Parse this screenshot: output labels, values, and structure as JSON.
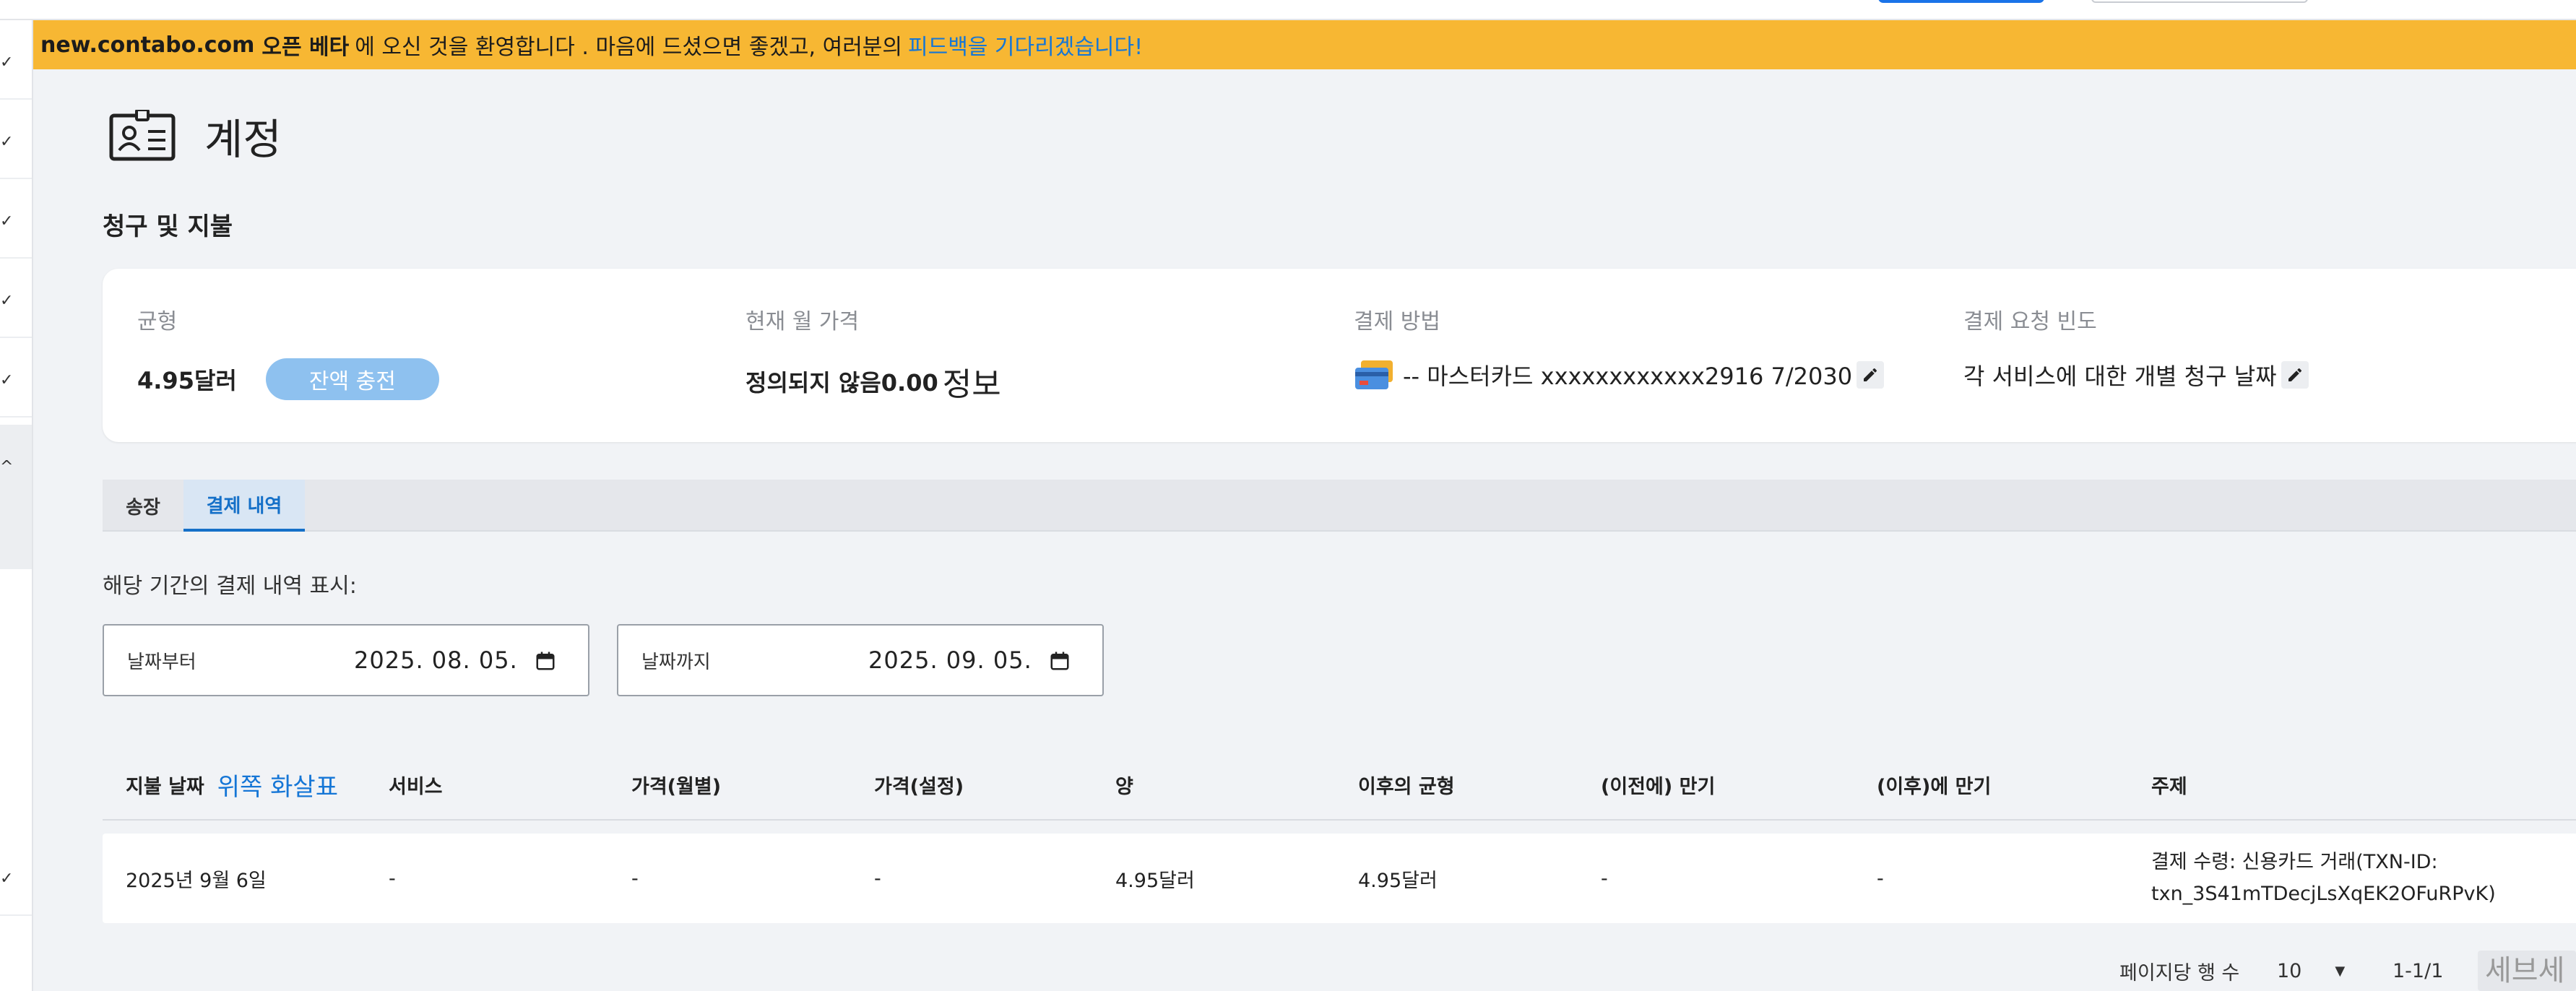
{
  "banner": {
    "site": "new.contabo.com",
    "beta": "오픈 베타",
    "welcome": "에 오신 것을 환영합니다 . 마음에 드셨으면 좋겠고, 여러분의",
    "feedback_link": "피드백을 기다리겠습니다!"
  },
  "page": {
    "title": "계정",
    "icon": "account-card-icon",
    "section_title": "청구 및 지불"
  },
  "summary": {
    "balance_label": "균형",
    "balance_value": "4.95달러",
    "topup_label": "잔액 충전",
    "monthly_label": "현재 월 가격",
    "monthly_value": "정의되지 않음0.00",
    "monthly_suffix": "정보",
    "payment_label": "결제 방법",
    "payment_value": "-- 마스터카드 xxxxxxxxxxxx2916 7/2030",
    "frequency_label": "결제 요청 빈도",
    "frequency_value": "각 서비스에 대한 개별 청구 날짜"
  },
  "tabs": [
    {
      "label": "송장",
      "active": false
    },
    {
      "label": "결제 내역",
      "active": true
    }
  ],
  "filter": {
    "period_label": "해당 기간의 결제 내역 표시:",
    "from_label": "날짜부터",
    "from_value": "2025. 08. 05.",
    "to_label": "날짜까지",
    "to_value": "2025. 09. 05."
  },
  "table": {
    "columns": [
      "지불 날짜",
      "서비스",
      "가격(월별)",
      "가격(설정)",
      "양",
      "이후의 균형",
      "(이전에) 만기",
      "(이후)에 만기",
      "주제"
    ],
    "sort_indicator": "위쪽 화살표",
    "rows": [
      {
        "date": "2025년 9월 6일",
        "service": "-",
        "price_monthly": "-",
        "price_setup": "-",
        "amount": "4.95달러",
        "balance_after": "4.95달러",
        "due_before": "-",
        "due_after": "-",
        "subject_line1": "결제 수령: 신용카드 거래(TXN-ID:",
        "subject_line2": "txn_3S41mTDecjLsXqEK2OFuRPvK)"
      }
    ]
  },
  "pagination": {
    "rows_per_page_label": "페이지당 행 수",
    "rows_per_page_value": "10",
    "range": "1-1/1"
  },
  "chat_widget_text": "세브세"
}
